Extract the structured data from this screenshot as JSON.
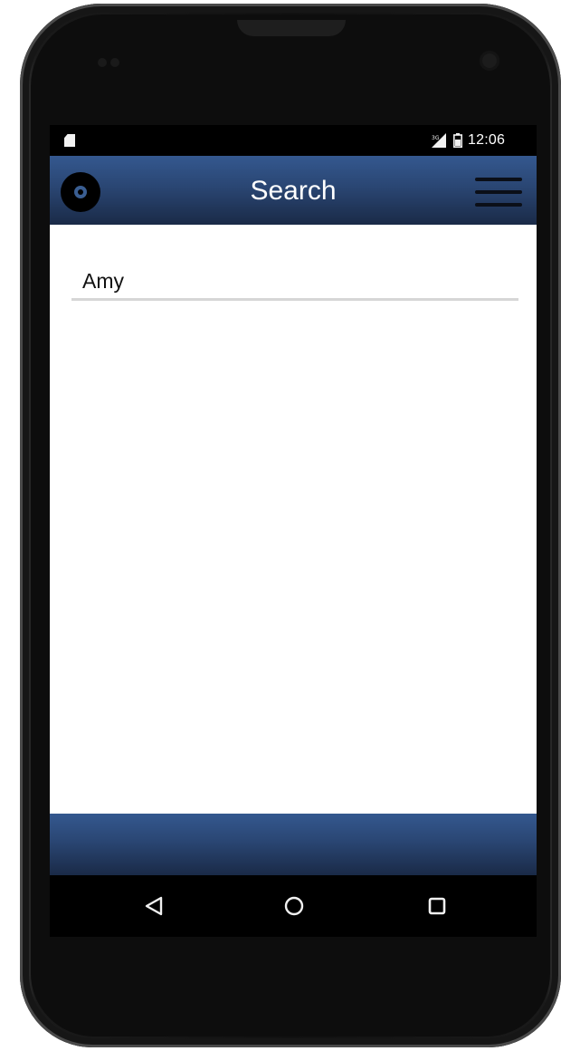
{
  "status_bar": {
    "time": "12:06",
    "network_label": "3G"
  },
  "app_bar": {
    "title": "Search"
  },
  "search": {
    "value": "Amy"
  },
  "colors": {
    "app_bar": "#2a4673",
    "background": "#ffffff",
    "input_underline": "#d6d6d6"
  },
  "icons": {
    "status_left": "sd-card-icon",
    "signal": "signal-icon",
    "battery": "battery-icon",
    "logo": "app-logo-icon",
    "menu": "hamburger-menu-icon",
    "nav_back": "back-triangle-icon",
    "nav_home": "home-circle-icon",
    "nav_recents": "recents-square-icon"
  }
}
